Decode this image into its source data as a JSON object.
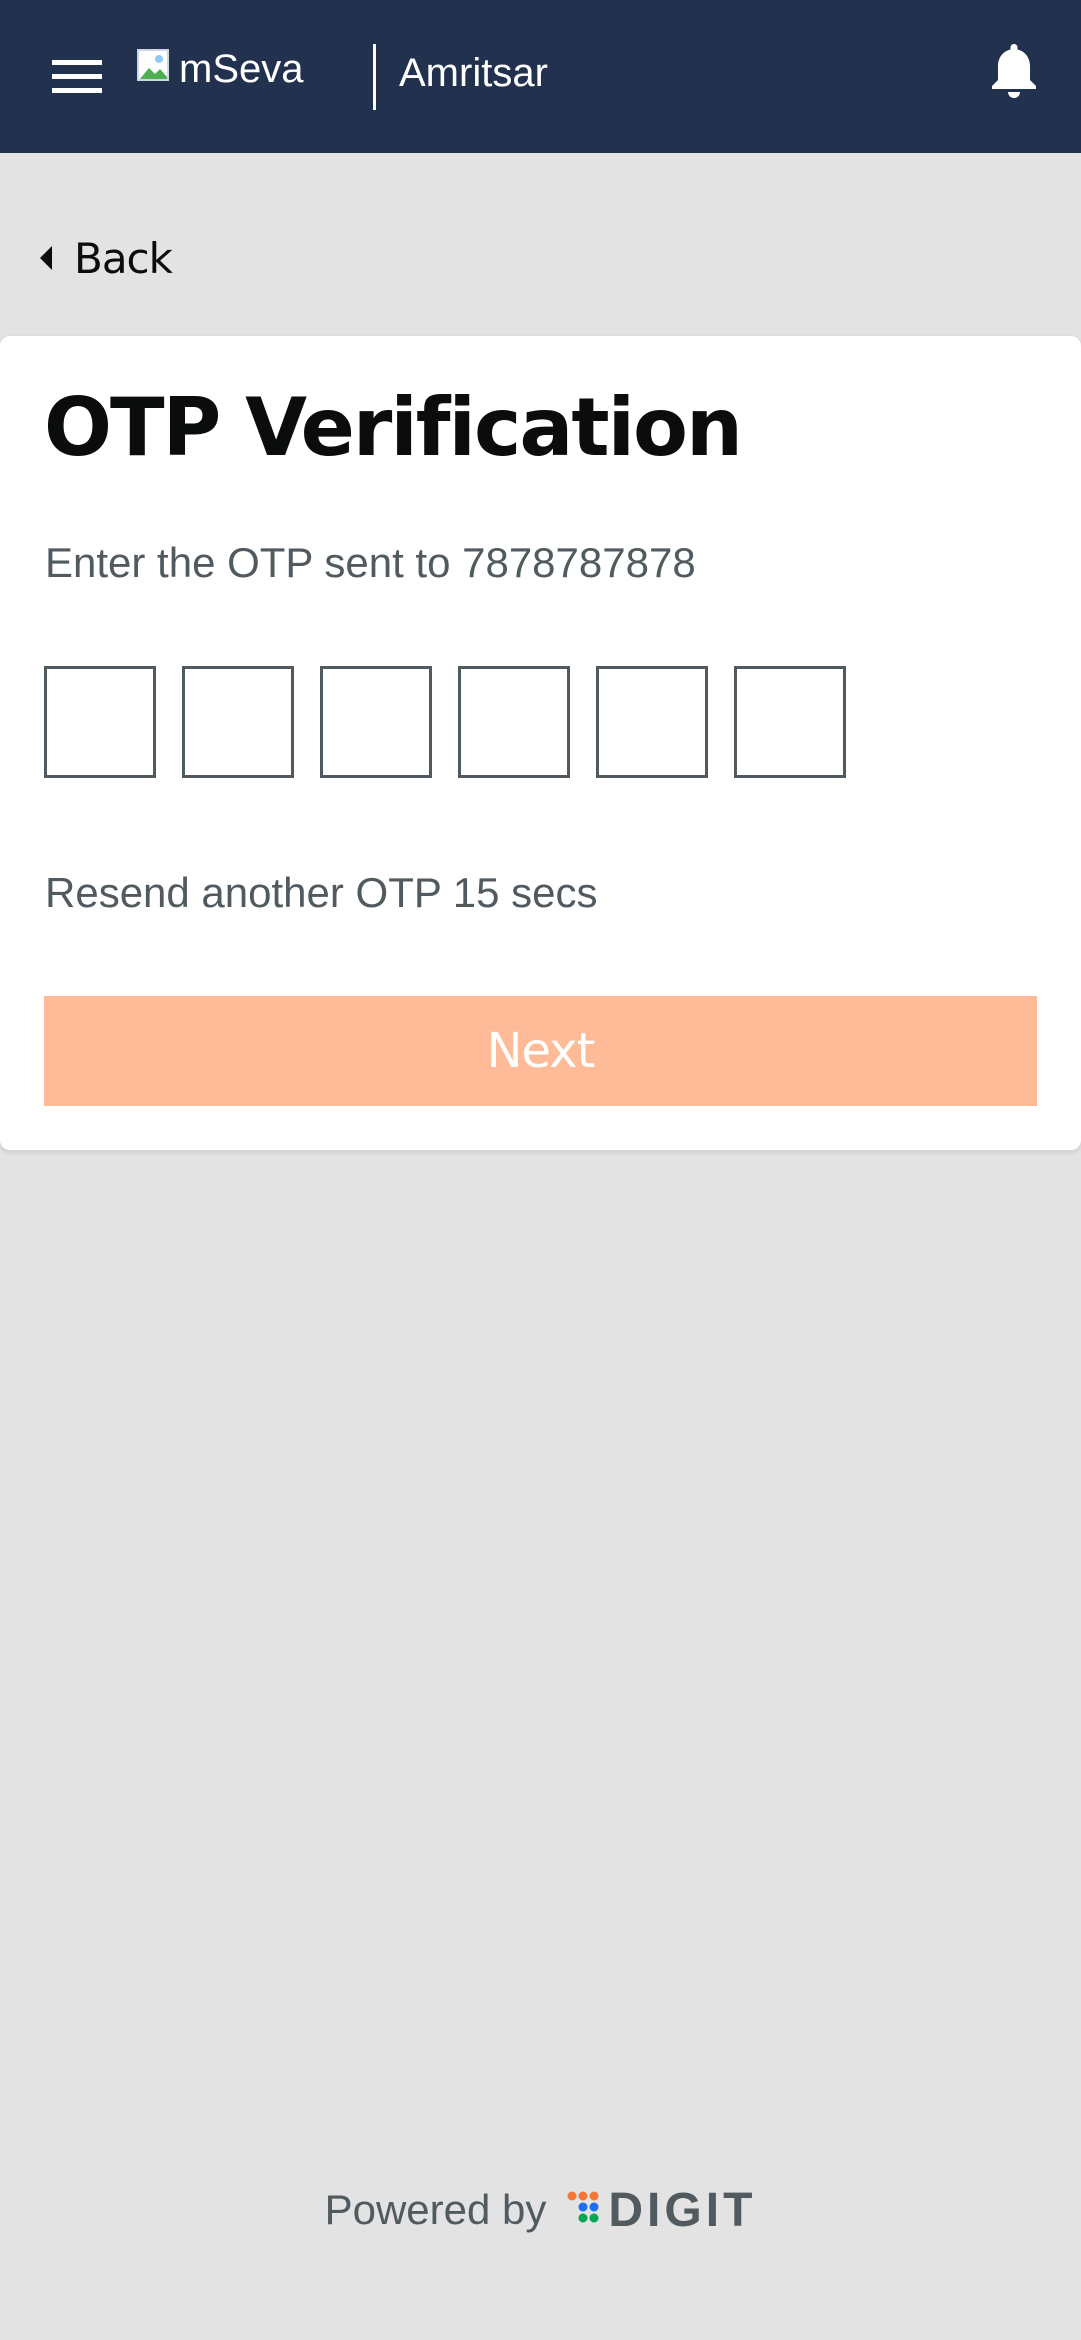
{
  "header": {
    "logo_text": "mSeva",
    "city": "Amritsar",
    "background": "#22314d"
  },
  "back": {
    "label": "Back"
  },
  "otp": {
    "title": "OTP Verification",
    "hint": "Enter the OTP sent to 7878787878",
    "boxes": [
      "",
      "",
      "",
      "",
      "",
      ""
    ],
    "resend": "Resend another OTP 15 secs",
    "next_label": "Next",
    "next_color": "#ffbb98"
  },
  "footer": {
    "powered_by": "Powered by",
    "brand": "DIGIT"
  }
}
